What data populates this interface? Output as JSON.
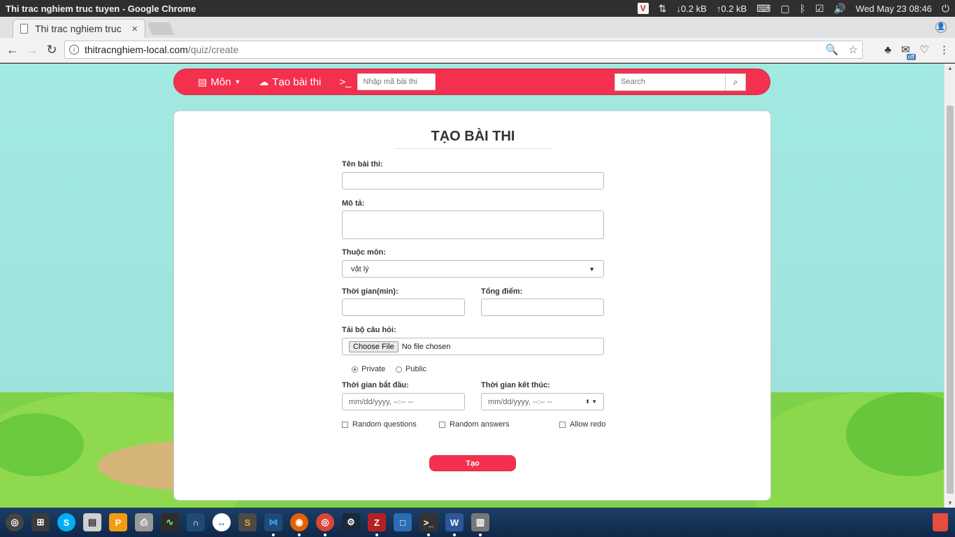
{
  "window": {
    "title": "Thi trac nghiem truc tuyen - Google Chrome"
  },
  "tray": {
    "vpn_label": "V",
    "net_down": "↓0.2 kB",
    "net_up": "↑0.2 kB",
    "clock": "Wed May 23 08:46"
  },
  "browser": {
    "tab_title": "Thi trac nghiem truc",
    "url_host": "thitracnghiem-local.com",
    "url_path": "/quiz/create",
    "ext_badge": "off"
  },
  "navbar": {
    "subjects_label": "Môn",
    "create_label": "Tạo bài thi",
    "code_placeholder": "Nhập mã bài thi",
    "search_placeholder": "Search"
  },
  "form": {
    "title": "TẠO BÀI THI",
    "name_label": "Tên bài thi:",
    "name_value": "",
    "desc_label": "Mô tả:",
    "desc_value": "",
    "subject_label": "Thuộc môn:",
    "subject_value": "vật lý",
    "duration_label": "Thời gian(min):",
    "duration_value": "",
    "total_label": "Tổng điểm:",
    "total_value": "",
    "upload_label": "Tải bộ câu hỏi:",
    "file_button": "Choose File",
    "file_status": "No file chosen",
    "visibility_private": "Private",
    "visibility_public": "Public",
    "visibility_selected": "Private",
    "start_label": "Thời gian bắt đầu:",
    "start_placeholder": "mm/dd/yyyy, --:-- --",
    "end_label": "Thời gian kết thúc:",
    "end_placeholder": "mm/dd/yyyy, --:-- --",
    "random_questions": "Random questions",
    "random_answers": "Random answers",
    "allow_redo": "Allow redo",
    "submit": "Tạo"
  },
  "colors": {
    "accent": "#f4304f",
    "sky": "#a2e9e1",
    "grass": "#7fd14a"
  },
  "taskbar": {
    "apps": [
      "ubuntu-dash",
      "workspaces",
      "skype",
      "files",
      "pdf-editor",
      "scanner",
      "system-monitor",
      "oscilloscope",
      "teamviewer",
      "sublime-text",
      "vscode",
      "firefox",
      "chrome",
      "steam",
      "filezilla",
      "virtualbox",
      "terminal",
      "word",
      "archive",
      "trash"
    ]
  }
}
